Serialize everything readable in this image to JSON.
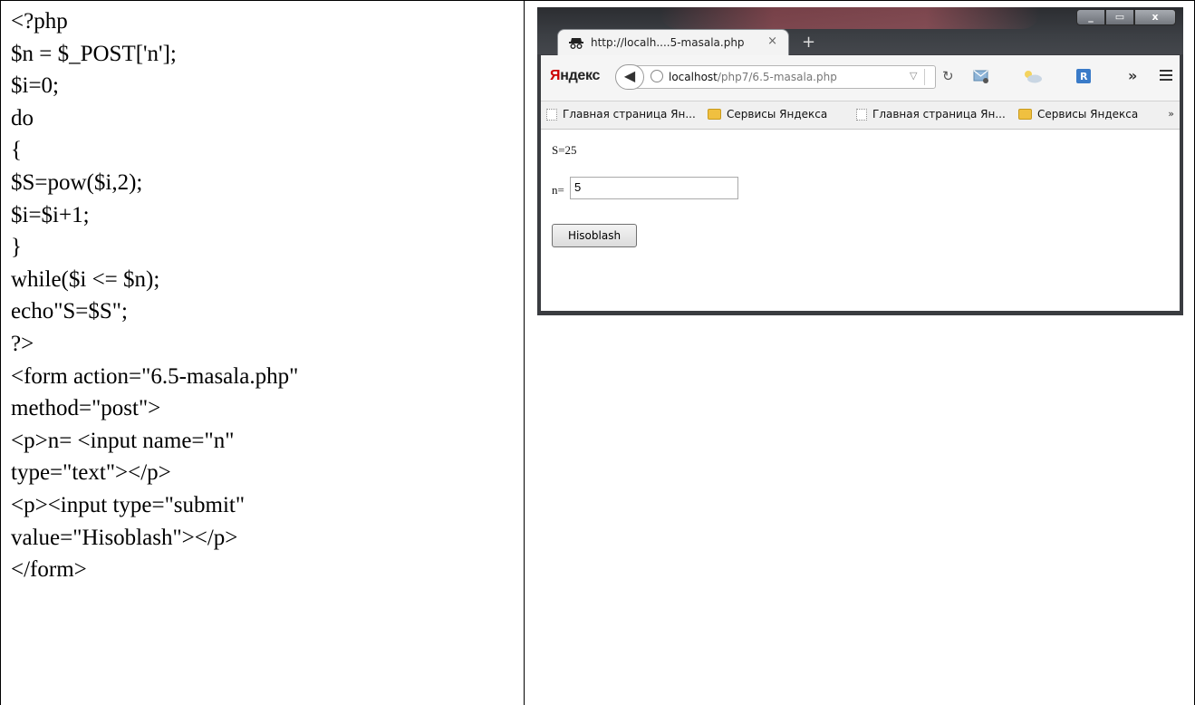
{
  "code_lines": [
    "<?php",
    "$n = $_POST['n'];",
    "$i=0;",
    "do",
    "{",
    "$S=pow($i,2);",
    "$i=$i+1;",
    "}",
    "while($i <= $n);",
    "echo\"S=$S\";",
    "?>",
    "<form action=\"6.5-masala.php\"",
    "method=\"post\">",
    "<p>n= <input name=\"n\"",
    "type=\"text\"></p>",
    "<p><input type=\"submit\"",
    "value=\"Hisoblash\"></p>",
    "</form>"
  ],
  "browser": {
    "tab_title": "http://localh....5-masala.php",
    "tab_close": "×",
    "new_tab": "+",
    "yandex_logo_first": "Я",
    "yandex_logo_rest": "ндекс",
    "url_host": "localhost",
    "url_path": "/php7/6.5-masala.php",
    "more": "»",
    "window_controls": [
      "_",
      "▭",
      "x"
    ],
    "bookmarks": [
      {
        "label": "Главная страница Ян...",
        "icon": "page-icon"
      },
      {
        "label": "Сервисы Яндекса",
        "icon": "folder-icon"
      },
      {
        "label": "Главная страница Ян...",
        "icon": "page-icon"
      },
      {
        "label": "Сервисы Яндекса",
        "icon": "folder-icon"
      }
    ],
    "bookmarks_overflow": "»"
  },
  "page": {
    "result": "S=25",
    "n_label": "n=",
    "n_value": "5",
    "submit_label": "Hisoblash"
  }
}
